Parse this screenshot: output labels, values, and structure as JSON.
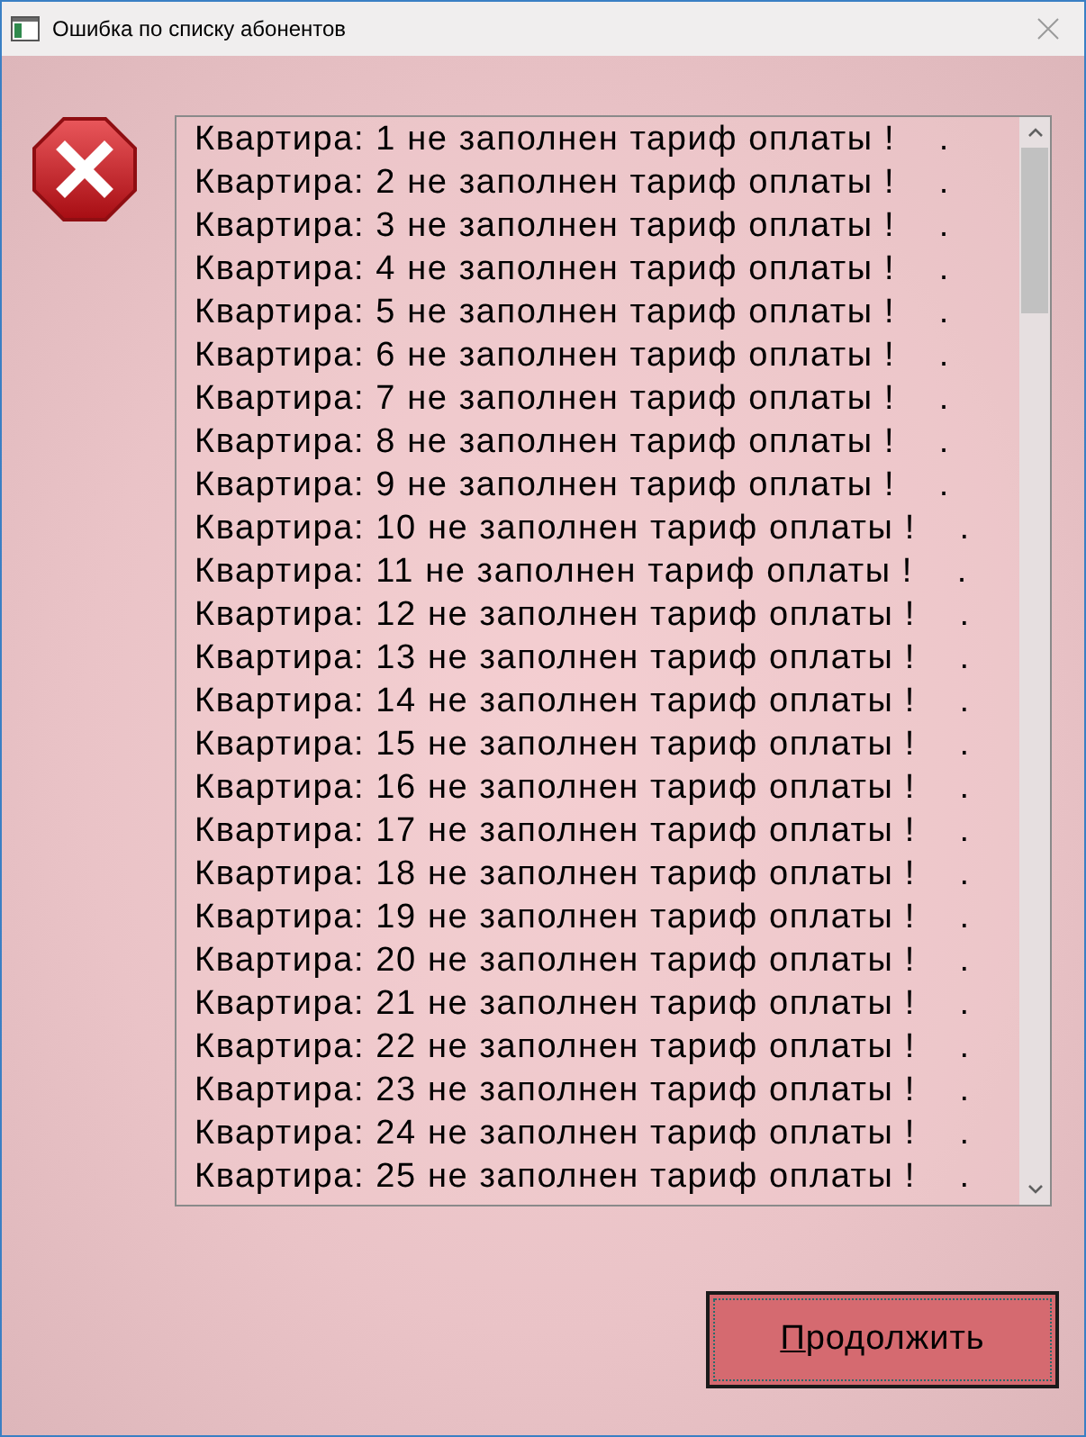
{
  "window": {
    "title": "Ошибка по списку абонентов"
  },
  "messages": [
    "Квартира: 1 не заполнен тариф оплаты !    .",
    "Квартира: 2 не заполнен тариф оплаты !    .",
    "Квартира: 3 не заполнен тариф оплаты !    .",
    "Квартира: 4 не заполнен тариф оплаты !    .",
    "Квартира: 5 не заполнен тариф оплаты !    .",
    "Квартира: 6 не заполнен тариф оплаты !    .",
    "Квартира: 7 не заполнен тариф оплаты !    .",
    "Квартира: 8 не заполнен тариф оплаты !    .",
    "Квартира: 9 не заполнен тариф оплаты !    .",
    "Квартира: 10 не заполнен тариф оплаты !    .",
    "Квартира: 11 не заполнен тариф оплаты !    .",
    "Квартира: 12 не заполнен тариф оплаты !    .",
    "Квартира: 13 не заполнен тариф оплаты !    .",
    "Квартира: 14 не заполнен тариф оплаты !    .",
    "Квартира: 15 не заполнен тариф оплаты !    .",
    "Квартира: 16 не заполнен тариф оплаты !    .",
    "Квартира: 17 не заполнен тариф оплаты !    .",
    "Квартира: 18 не заполнен тариф оплаты !    .",
    "Квартира: 19 не заполнен тариф оплаты !    .",
    "Квартира: 20 не заполнен тариф оплаты !    .",
    "Квартира: 21 не заполнен тариф оплаты !    .",
    "Квартира: 22 не заполнен тариф оплаты !    .",
    "Квартира: 23 не заполнен тариф оплаты !    .",
    "Квартира: 24 не заполнен тариф оплаты !    .",
    "Квартира: 25 не заполнен тариф оплаты !    ."
  ],
  "buttons": [
    {
      "label": "Продолжить",
      "underline_first_letter": true,
      "focused": true
    }
  ]
}
